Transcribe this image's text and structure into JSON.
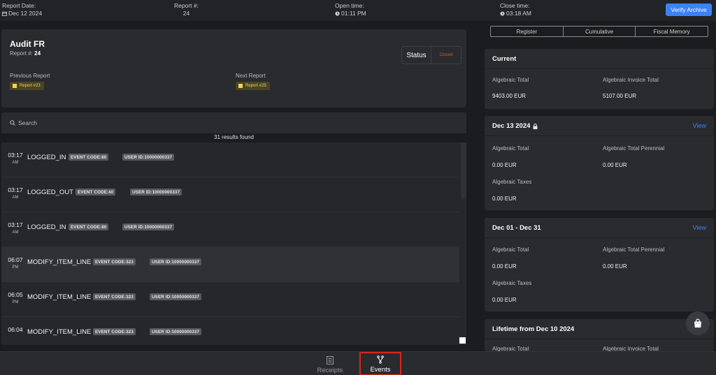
{
  "topbar": {
    "report_date_label": "Report Date:",
    "report_date_value": "Dec 12 2024",
    "report_num_label": "Report #:",
    "report_num_value": "24",
    "open_time_label": "Open time:",
    "open_time_value": "01:11 PM",
    "close_time_label": "Close time:",
    "close_time_value": "03:18 AM",
    "verify_button": "Verify Archive"
  },
  "audit": {
    "title": "Audit FR",
    "report_label": "Report #:",
    "report_value": "24",
    "status_label": "Status",
    "status_value": "Closed",
    "previous_label": "Previous Report",
    "previous_chip": "Report #23",
    "next_label": "Next Report",
    "next_chip": "Report #25"
  },
  "search": {
    "placeholder": "Search",
    "results_text": "31 results found"
  },
  "events": [
    {
      "time": "03:17",
      "ampm": "AM",
      "name": "LOGGED_IN",
      "code": "EVENT CODE:80",
      "user": "USER ID:10000000337"
    },
    {
      "time": "03:17",
      "ampm": "AM",
      "name": "LOGGED_OUT",
      "code": "EVENT CODE:40",
      "user": "USER ID:10000000337"
    },
    {
      "time": "03:17",
      "ampm": "AM",
      "name": "LOGGED_IN",
      "code": "EVENT CODE:80",
      "user": "USER ID:10000000337"
    },
    {
      "time": "06:07",
      "ampm": "PM",
      "name": "MODIFY_ITEM_LINE",
      "code": "EVENT CODE:323",
      "user": "USER ID:10000000337"
    },
    {
      "time": "06:05",
      "ampm": "PM",
      "name": "MODIFY_ITEM_LINE",
      "code": "EVENT CODE:323",
      "user": "USER ID:10000000337"
    },
    {
      "time": "06:04",
      "ampm": "",
      "name": "MODIFY_ITEM_LINE",
      "code": "EVENT CODE:323",
      "user": "USER ID:10000000337"
    }
  ],
  "tabs": [
    "Register",
    "Cumulative",
    "Fiscal Memory"
  ],
  "current": {
    "title": "Current",
    "label1": "Algebraic Total",
    "value1": "9403.00 EUR",
    "label2": "Algebraic Invoice Total",
    "value2": "5107.00 EUR"
  },
  "day": {
    "title": "Dec 13 2024",
    "view": "View",
    "label1": "Algebraic Total",
    "value1": "0.00 EUR",
    "label2": "Algebraic Total Perennial",
    "value2": "0.00 EUR",
    "label3": "Algebraic Taxes",
    "value3": "0.00 EUR"
  },
  "month": {
    "title": "Dec 01 - Dec 31",
    "view": "View",
    "label1": "Algebraic Total",
    "value1": "0.00 EUR",
    "label2": "Algebraic Total Perennial",
    "value2": "0.00 EUR",
    "label3": "Algebraic Taxes",
    "value3": "0.00 EUR"
  },
  "lifetime": {
    "title": "Lifetime from Dec 10 2024",
    "label1": "Algebraic Total",
    "label2": "Algebraic Invoice Total"
  },
  "bottom_nav": {
    "receipts": "Receipts",
    "events": "Events"
  },
  "colors": {
    "accent": "#3b82f6",
    "status_closed": "#e2533f",
    "chip_text": "#f0d94a",
    "active_outline": "#d9261c"
  }
}
